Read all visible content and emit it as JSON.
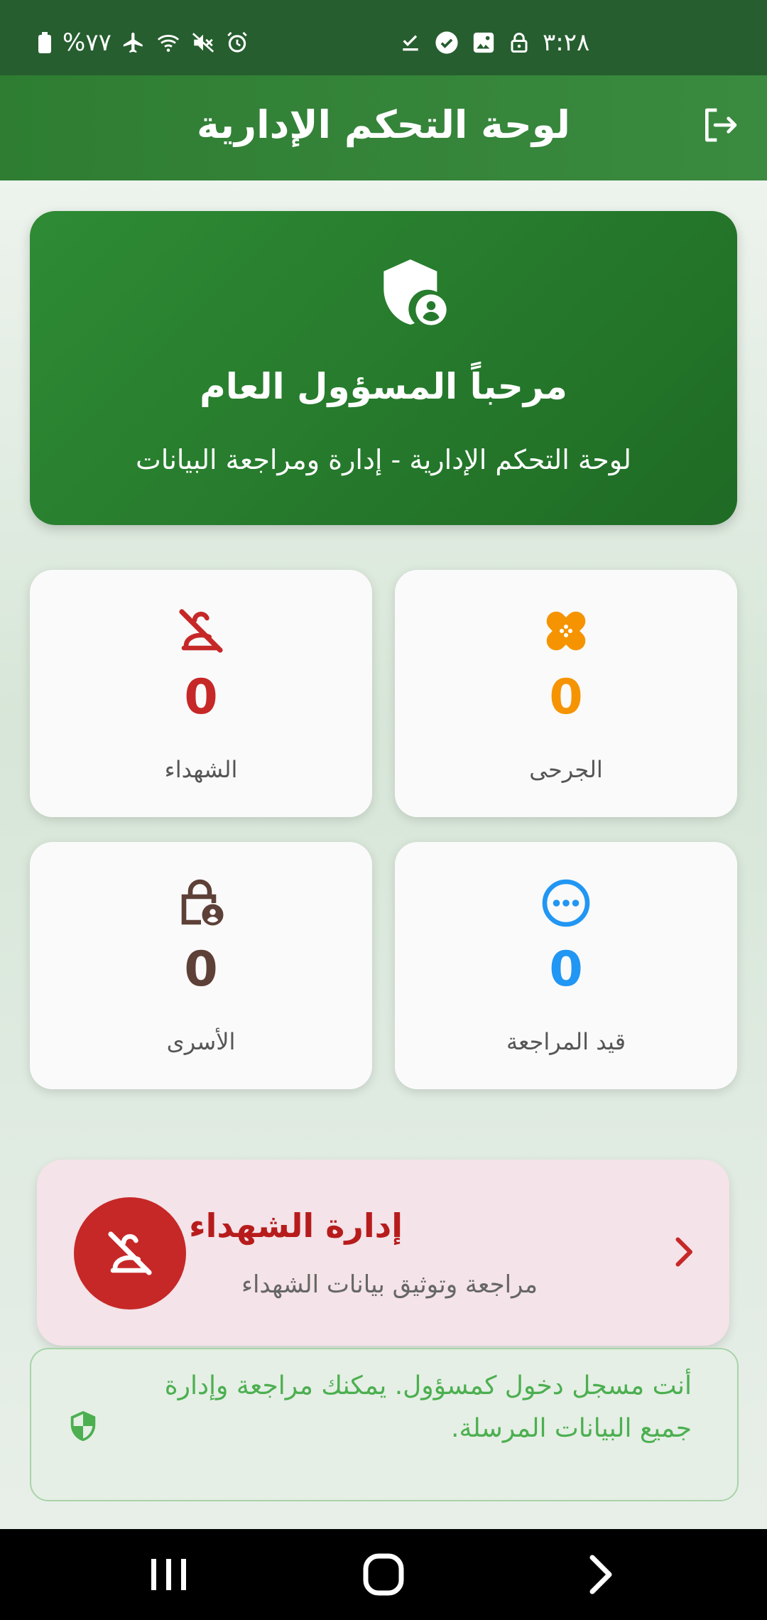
{
  "status_bar": {
    "battery_text": "%٧٧",
    "time": "٣:٢٨",
    "icons_left": [
      "battery-icon",
      "airplane-icon",
      "wifi-icon",
      "mute-icon",
      "alarm-icon"
    ],
    "icons_right": [
      "download-done-icon",
      "check-circle-icon",
      "image-icon",
      "lock-icon"
    ]
  },
  "app_bar": {
    "title": "لوحة التحكم الإدارية",
    "logout_icon": "logout-icon"
  },
  "welcome": {
    "icon": "admin-shield-icon",
    "title": "مرحباً المسؤول العام",
    "subtitle": "لوحة التحكم الإدارية - إدارة ومراجعة البيانات"
  },
  "stats": [
    {
      "label": "الجرحى",
      "value": "0",
      "color": "#f59400",
      "icon": "bandage-icon"
    },
    {
      "label": "الشهداء",
      "value": "0",
      "color": "#c62828",
      "icon": "person-off-icon"
    },
    {
      "label": "قيد المراجعة",
      "value": "0",
      "color": "#2196f3",
      "icon": "pending-icon"
    },
    {
      "label": "الأسرى",
      "value": "0",
      "color": "#5d4037",
      "icon": "lock-person-icon"
    }
  ],
  "management": {
    "title": "إدارة الشهداء",
    "subtitle": "مراجعة وتوثيق بيانات الشهداء",
    "icon": "person-off-icon",
    "chevron_icon": "chevron-right-icon",
    "accent": "#c62828"
  },
  "info": {
    "text": "أنت مسجل دخول كمسؤول. يمكنك مراجعة وإدارة جميع البيانات المرسلة.",
    "icon": "shield-icon",
    "color": "#4caf50"
  },
  "nav": [
    "recents-icon",
    "home-icon",
    "back-icon"
  ]
}
